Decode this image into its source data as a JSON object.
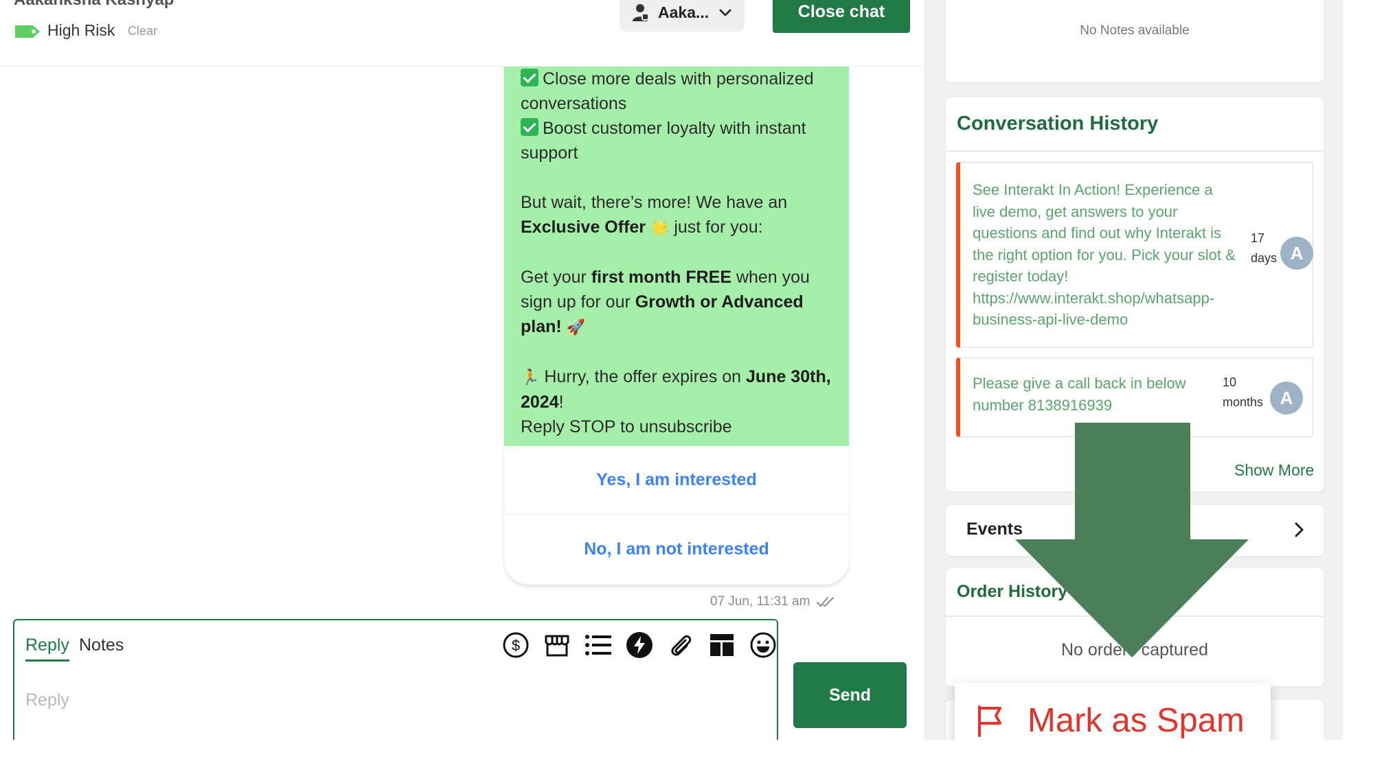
{
  "header": {
    "contact_name": "Aakanksha Kashyap",
    "tag_label": "High Risk",
    "tag_color": "#5ccf5e",
    "clear_label": "Clear",
    "agent_label": "Aaka...",
    "close_chat_label": "Close chat"
  },
  "message": {
    "bubble_color": "#a5efaa",
    "line1": "Close more deals with personalized conversations",
    "line2": "Boost customer loyalty with instant support",
    "p2_a": "But wait, there’s more! We have an ",
    "p2_b": "Exclusive Offer",
    "p2_c": " just for you:",
    "p3_a": "Get your ",
    "p3_b": "first month FREE",
    "p3_c": " when you sign up for our ",
    "p3_d": "Growth or Advanced plan",
    "p3_e": "!",
    "p4_a": " Hurry, the offer expires on ",
    "p4_b": "June 30th, 2024",
    "p4_c": "!",
    "p4_d": "Reply STOP to unsubscribe",
    "button_yes": "Yes, I am interested",
    "button_no": "No, I am not interested",
    "timestamp": "07 Jun, 11:31 am"
  },
  "composer": {
    "tab_reply": "Reply",
    "tab_notes": "Notes",
    "placeholder": "Reply",
    "send_label": "Send",
    "tools": [
      "dollar-icon",
      "store-icon",
      "list-icon",
      "bolt-icon",
      "paperclip-icon",
      "template-icon",
      "smiley-icon"
    ]
  },
  "sidebar": {
    "no_notes": "No Notes available",
    "history_title": "Conversation History",
    "history_items": [
      {
        "text": "See Interakt In Action!  Experience a live demo, get answers to your questions and find out why Interakt is the right option for you.  Pick your slot & register today! https://www.interakt.shop/whatsapp-business-api-live-demo",
        "time_num": "17",
        "time_unit": "days",
        "avatar": "A"
      },
      {
        "text": "Please give a call back in below number  8138916939",
        "time_num": "10",
        "time_unit": "months",
        "avatar": "A"
      }
    ],
    "show_more": "Show More",
    "events_label": "Events",
    "order_history_title": "Order History",
    "no_orders": "No orders captured",
    "spam_label": "Mark as Spam",
    "accent_green": "#1f7a45",
    "history_accent": "#f0541e"
  }
}
